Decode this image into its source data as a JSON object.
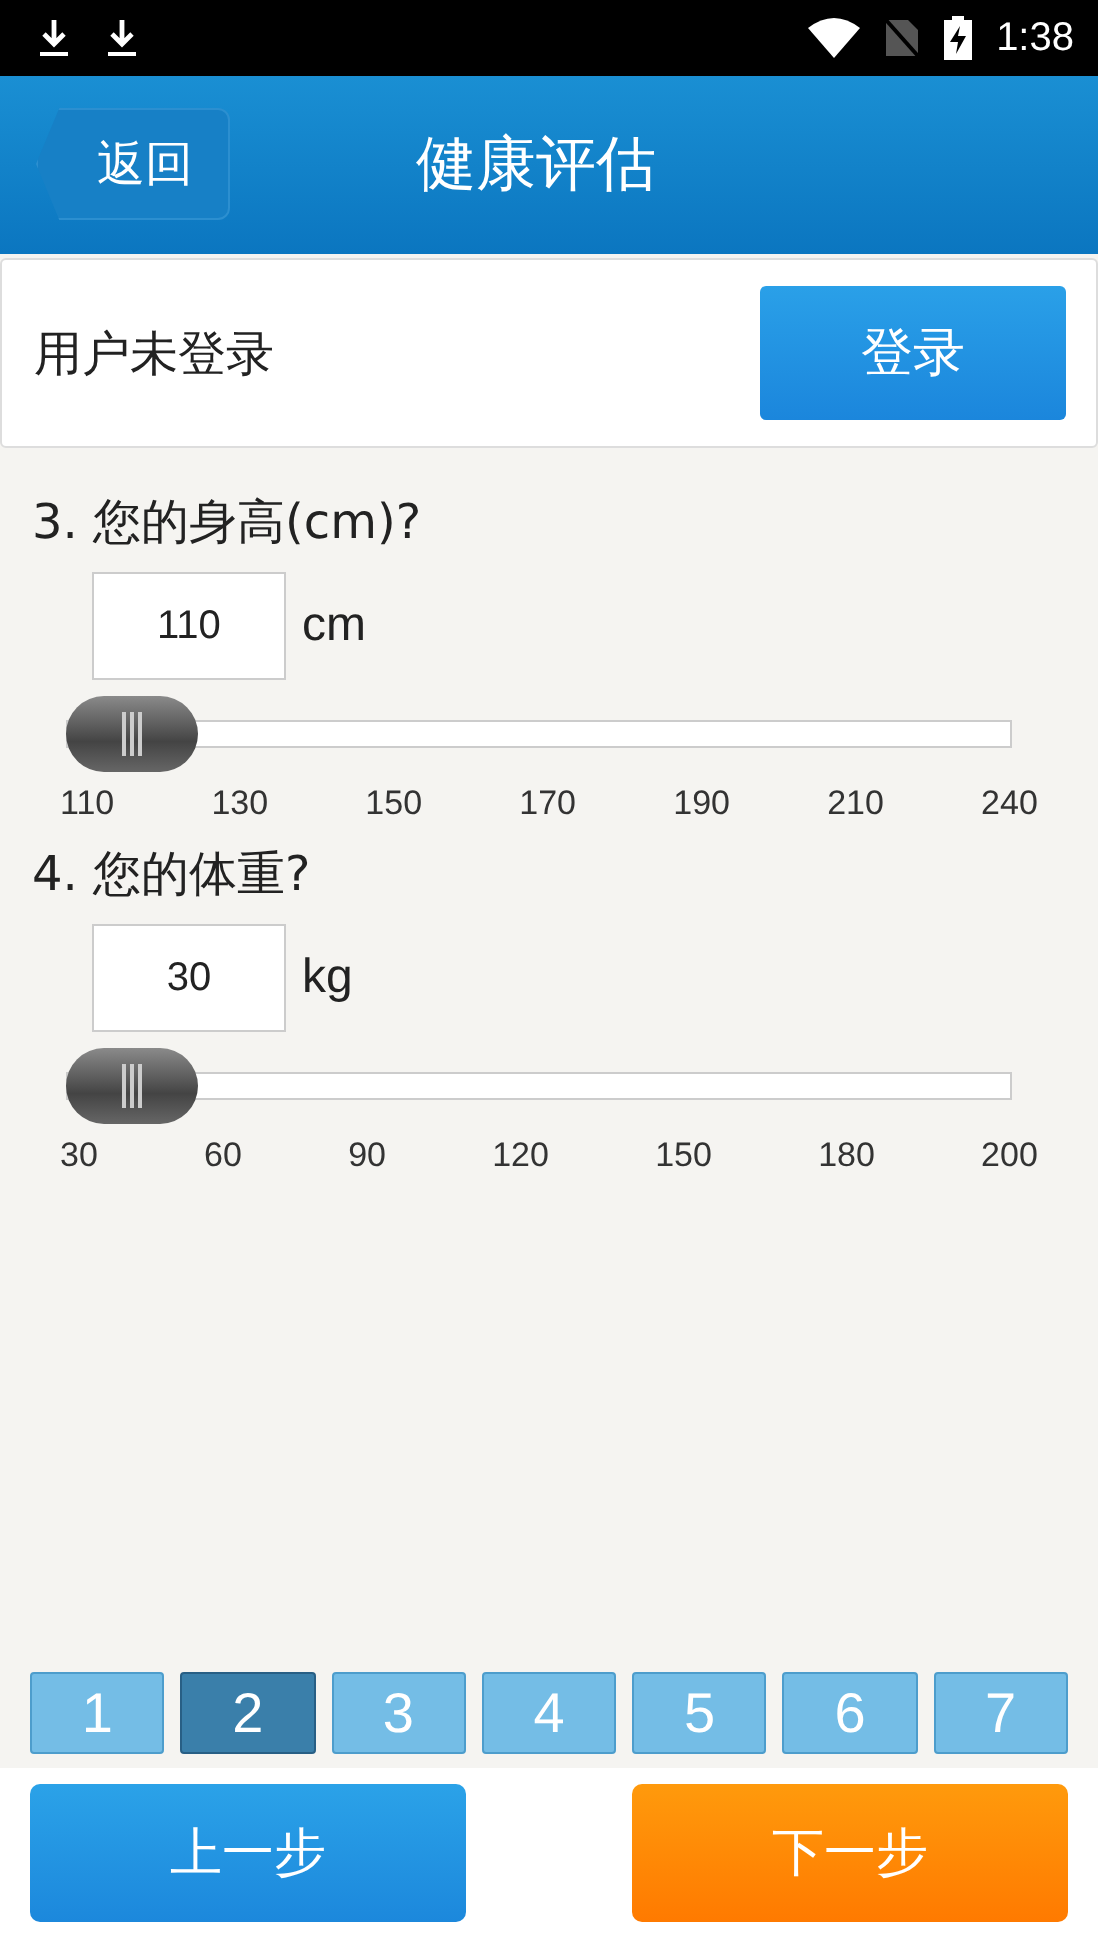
{
  "status_bar": {
    "time": "1:38"
  },
  "header": {
    "back": "返回",
    "title": "健康评估"
  },
  "login": {
    "message": "用户未登录",
    "button": "登录"
  },
  "questions": [
    {
      "label": "3. 您的身高(cm)?",
      "value": "110",
      "unit": "cm",
      "level": 0,
      "ticks": [
        "110",
        "130",
        "150",
        "170",
        "190",
        "210",
        "240"
      ]
    },
    {
      "label": "4. 您的体重?",
      "value": "30",
      "unit": "kg",
      "level": 0,
      "ticks": [
        "30",
        "60",
        "90",
        "120",
        "150",
        "180",
        "200"
      ]
    }
  ],
  "pages": [
    {
      "label": "1",
      "selected": false
    },
    {
      "label": "2",
      "selected": true
    },
    {
      "label": "3",
      "selected": false
    },
    {
      "label": "4",
      "selected": false
    },
    {
      "label": "5",
      "selected": false
    },
    {
      "label": "6",
      "selected": false
    },
    {
      "label": "7",
      "selected": false
    }
  ],
  "buttons": {
    "previous": "上一步",
    "next": "下一步"
  }
}
